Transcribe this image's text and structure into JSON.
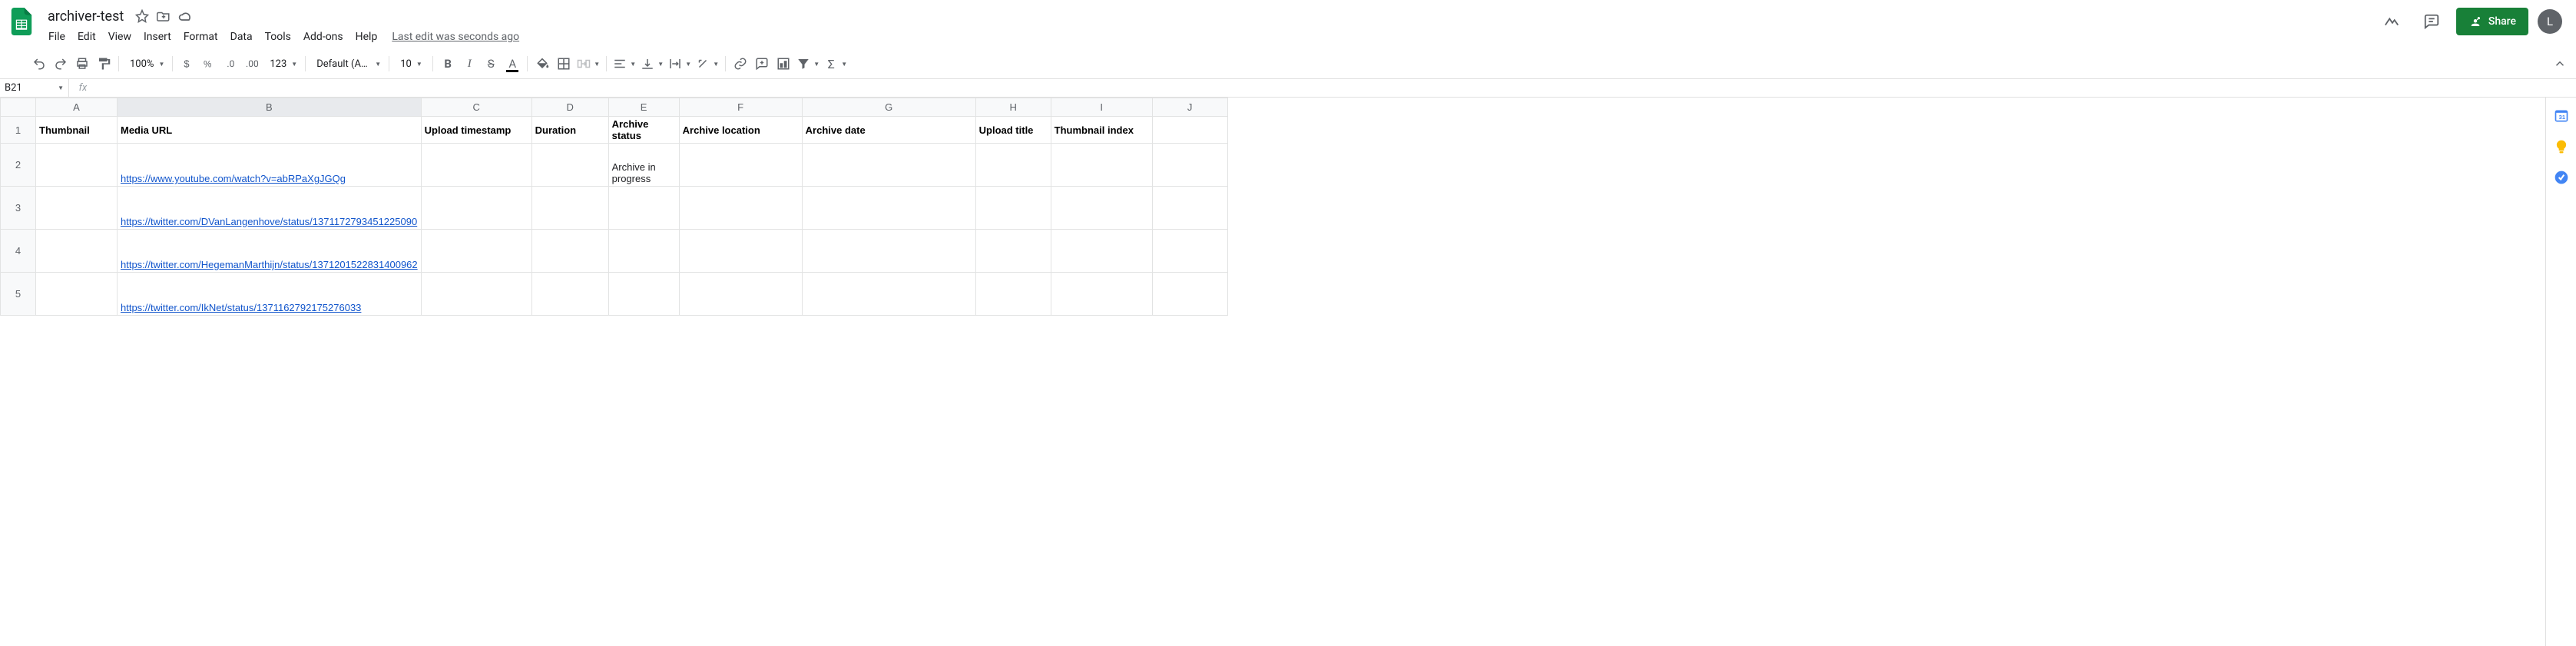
{
  "doc": {
    "title": "archiver-test"
  },
  "menu": {
    "file": "File",
    "edit": "Edit",
    "view": "View",
    "insert": "Insert",
    "format": "Format",
    "data": "Data",
    "tools": "Tools",
    "addons": "Add-ons",
    "help": "Help",
    "last_edit": "Last edit was seconds ago"
  },
  "share": {
    "label": "Share"
  },
  "avatar": {
    "initial": "L"
  },
  "toolbar": {
    "zoom": "100%",
    "font": "Default (Ari...",
    "font_size": "10",
    "more_formats": "123"
  },
  "name_box": {
    "value": "B21"
  },
  "columns": [
    "A",
    "B",
    "C",
    "D",
    "E",
    "F",
    "G",
    "H",
    "I",
    "J"
  ],
  "headers": {
    "A": "Thumbnail",
    "B": "Media URL",
    "C": "Upload timestamp",
    "D": "Duration",
    "E": "Archive status",
    "F": "Archive location",
    "G": "Archive date",
    "H": "Upload title",
    "I": "Thumbnail index"
  },
  "rows": [
    {
      "n": 2,
      "B": "https://www.youtube.com/watch?v=abRPaXgJGQg",
      "E": "Archive in progress"
    },
    {
      "n": 3,
      "B": "https://twitter.com/DVanLangenhove/status/1371172793451225090"
    },
    {
      "n": 4,
      "B": "https://twitter.com/HegemanMarthijn/status/1371201522831400962"
    },
    {
      "n": 5,
      "B": "https://twitter.com/IkNet/status/1371162792175276033"
    }
  ]
}
